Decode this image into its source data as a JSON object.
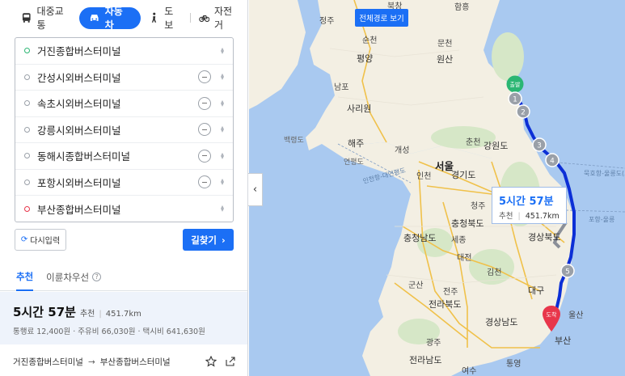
{
  "modes": {
    "transit": "대중교통",
    "car": "자동차",
    "walk": "도보",
    "bike": "자전거"
  },
  "stops": [
    {
      "name": "거진종합버스터미널",
      "kind": "start"
    },
    {
      "name": "간성시외버스터미널",
      "kind": "via"
    },
    {
      "name": "속초시외버스터미널",
      "kind": "via"
    },
    {
      "name": "강릉시외버스터미널",
      "kind": "via"
    },
    {
      "name": "동해시종합버스터미널",
      "kind": "via"
    },
    {
      "name": "포항시외버스터미널",
      "kind": "via"
    },
    {
      "name": "부산종합버스터미널",
      "kind": "end"
    }
  ],
  "buttons": {
    "reset": "다시입력",
    "search": "길찾기"
  },
  "tabs": {
    "recommended": "추천",
    "toll_priority": "이륜차우선",
    "help": "?"
  },
  "result": {
    "time": "5시간 57분",
    "tag": "추천",
    "distance": "451.7km",
    "fees": "통행료 12,400원 · 주유비 66,030원 · 택시비 641,630원"
  },
  "route_name": {
    "from": "거진종합버스터미널",
    "arrow": "→",
    "to": "부산종합버스터미널"
  },
  "map": {
    "full_route_button": "전체경로 보기",
    "callout_time": "5시간 57분",
    "callout_tag": "추천",
    "callout_distance": "451.7km",
    "start_marker": "출발",
    "end_marker": "도착",
    "waypoints": [
      "1",
      "2",
      "3",
      "4",
      "5"
    ],
    "labels": {
      "hamheung": "함흥",
      "jeongju": "정주",
      "bukchang": "북창",
      "suncheon": "순천",
      "munchon": "문천",
      "pyongyang": "평양",
      "wonsan": "원산",
      "nampo": "남포",
      "sariwon": "사리원",
      "gangwon": "강원도",
      "chuncheon": "춘천",
      "haeju": "해주",
      "kaesong": "개성",
      "seoul": "서울",
      "incheon": "인천",
      "gyeonggi": "경기도",
      "cheongju": "청주",
      "chungbuk": "충청북도",
      "chungnam": "충청남도",
      "sejong": "세종",
      "daejeon": "대전",
      "gyeongbuk": "경상북도",
      "gimcheon": "김천",
      "daegu": "대구",
      "gunsan": "군산",
      "jeonbuk": "전라북도",
      "jeonju": "전주",
      "gyeongnam": "경상남도",
      "ulsan": "울산",
      "busan": "부산",
      "gwangju": "광주",
      "jeonnam": "전라남도",
      "yeosu": "여수",
      "tongyeong": "통영",
      "baengnyeong": "백령도",
      "yeonpyeong": "연평도",
      "incheon_line": "인천항-대연평도",
      "bukhang": "묵호항-울릉도(도동)",
      "pohang": "포항-울릉"
    }
  }
}
